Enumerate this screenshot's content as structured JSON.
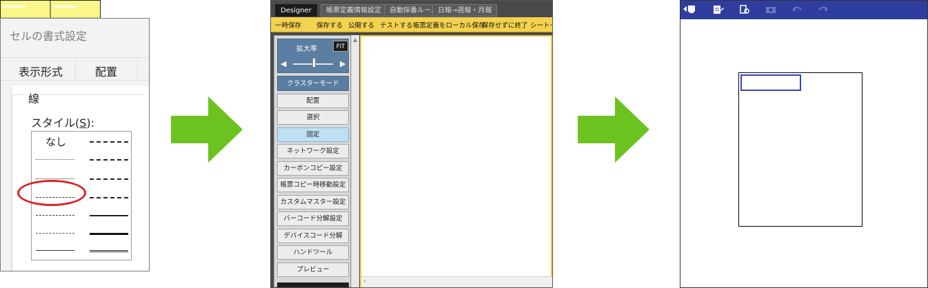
{
  "dialog": {
    "title": "セルの書式設定",
    "tabs": [
      "表示形式",
      "配置"
    ],
    "group_label": "線",
    "style_label_prefix": "スタイル(",
    "style_label_key": "S",
    "style_label_suffix": "):",
    "none_label": "なし"
  },
  "designer": {
    "tabs": [
      "Designer",
      "帳票定義情報設定",
      "自動採番ルール",
      "日報→週報・月報"
    ],
    "toolbar": [
      "一時保存",
      "保存する",
      "公開する",
      "テストする",
      "帳票定義をローカル保存",
      "保存せずに終了",
      "シート一覧"
    ],
    "zoom_label": "拡大率",
    "fit_label": "FIT",
    "cluster_mode_label": "クラスターモード",
    "side_buttons": [
      "配置",
      "選択",
      "固定",
      "ネットワーク設定",
      "カーボンコピー設定",
      "帳票コピー時移動設定",
      "カスタムマスター設定",
      "バーコード分解設定",
      "デバイスコード分解",
      "ハンドツール",
      "プレビュー"
    ],
    "selected_button": "固定",
    "colors": {
      "toolbar": "#f2d24e",
      "sidebar_header": "#5b7ea2",
      "form_fill": "#faf68a"
    }
  },
  "viewer": {
    "toolbar_icons": [
      "exit-icon",
      "form-edit-icon",
      "document-search-icon",
      "camera-icon",
      "undo-icon",
      "redo-icon"
    ],
    "colors": {
      "toolbar": "#2f3e9e",
      "selection": "#3344bb"
    }
  },
  "arrows": {
    "color": "#6cc21f"
  }
}
